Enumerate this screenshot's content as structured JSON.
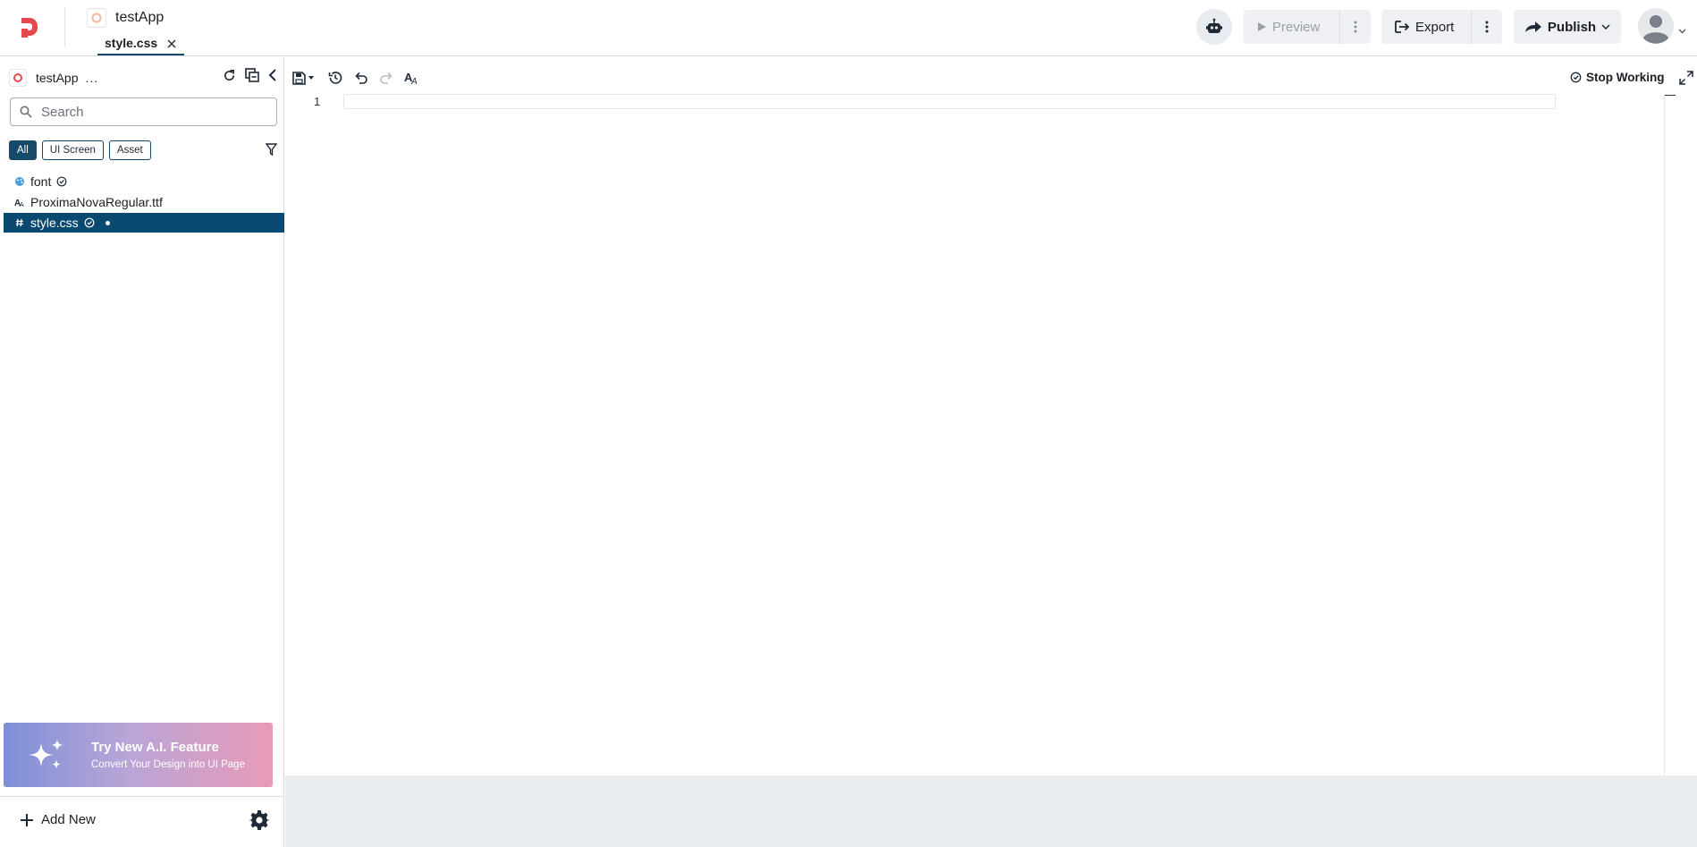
{
  "header": {
    "app_title": "testApp",
    "open_tab": "style.css",
    "preview_label": "Preview",
    "export_label": "Export",
    "publish_label": "Publish"
  },
  "sidebar": {
    "project_name": "testApp",
    "project_more": "...",
    "search": {
      "placeholder": "Search",
      "value": ""
    },
    "filters": [
      {
        "label": "All",
        "active": true
      },
      {
        "label": "UI Screen",
        "active": false
      },
      {
        "label": "Asset",
        "active": false
      }
    ],
    "files": [
      {
        "name": "font",
        "icon": "palette-icon"
      },
      {
        "name": "ProximaNovaRegular.ttf",
        "icon": "font-file-icon"
      },
      {
        "name": "style.css",
        "icon": "css-file-icon",
        "selected": true,
        "unsaved": true
      }
    ],
    "ai_banner": {
      "title": "Try New A.I. Feature",
      "subtitle": "Convert Your Design into UI Page"
    },
    "add_new_label": "Add New"
  },
  "editor": {
    "stop_working_label": "Stop Working",
    "line_numbers": [
      "1"
    ]
  },
  "colors": {
    "accent": "#17496b",
    "selected_row": "#0b4a70",
    "brand": "#e5484d",
    "banner_start": "#7e8fd8",
    "banner_end": "#e89ab7"
  }
}
